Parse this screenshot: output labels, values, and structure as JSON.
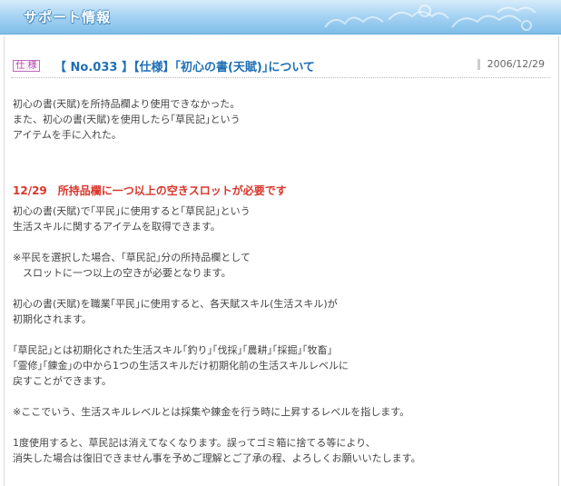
{
  "banner": {
    "title": "サポート情報"
  },
  "article": {
    "category": "仕 様",
    "title": "【 No.033 】【仕様】｢初心の書(天賦)｣について",
    "date": "2006/12/29",
    "intro": [
      "初心の書(天賦)を所持品欄より使用できなかった。",
      "また、初心の書(天賦)を使用したら｢草民記｣という",
      "アイテムを手に入れた。"
    ],
    "update_heading": "12/29　所持品欄に一つ以上の空きスロットが必要です",
    "body": [
      "初心の書(天賦)で｢平民｣に使用すると｢草民記｣という",
      "生活スキルに関するアイテムを取得できます。",
      "",
      "※平民を選択した場合、｢草民記｣分の所持品欄として",
      "　スロットに一つ以上の空きが必要となります。",
      "",
      "初心の書(天賦)を職業｢平民｣に使用すると、各天賦スキル(生活スキル)が",
      "初期化されます。",
      "",
      "｢草民記｣とは初期化された生活スキル｢釣り｣｢伐採｣｢農耕｣｢採掘｣｢牧畜｣",
      "｢霊修｣｢錬金｣の中から1つの生活スキルだけ初期化前の生活スキルレベルに",
      "戻すことができます。",
      "",
      "※ここでいう、生活スキルレベルとは採集や錬金を行う時に上昇するレベルを指します。",
      "",
      "1度使用すると、草民記は消えてなくなります。誤ってゴミ箱に捨てる等により、",
      "消失した場合は復旧できません事を予めご理解とご了承の程、よろしくお願いいたします。"
    ]
  }
}
